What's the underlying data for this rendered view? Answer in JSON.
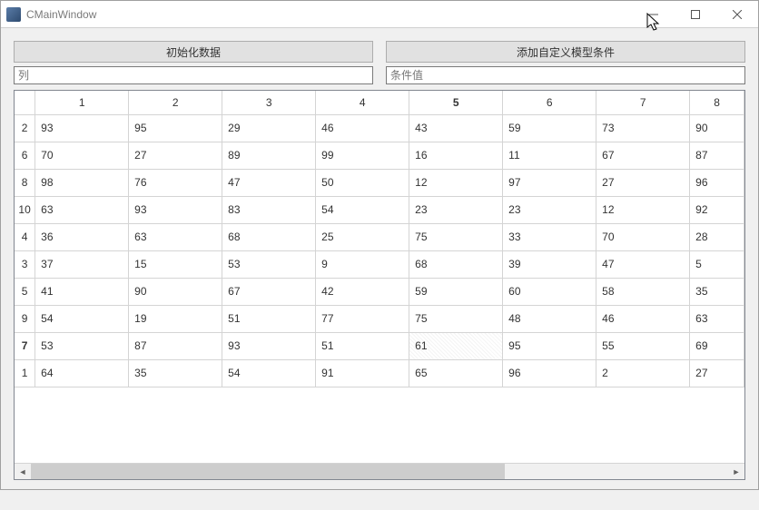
{
  "window": {
    "title": "CMainWindow"
  },
  "buttons": {
    "init": "初始化数据",
    "addcond": "添加自定义模型条件"
  },
  "inputs": {
    "col_placeholder": "列",
    "val_placeholder": "条件值"
  },
  "table": {
    "col_headers": [
      "1",
      "2",
      "3",
      "4",
      "5",
      "6",
      "7",
      "8"
    ],
    "bold_col_index": 4,
    "row_headers": [
      "2",
      "6",
      "8",
      "10",
      "4",
      "3",
      "5",
      "9",
      "7",
      "1"
    ],
    "bold_row_index": 8,
    "rows": [
      [
        "93",
        "95",
        "29",
        "46",
        "43",
        "59",
        "73",
        "90"
      ],
      [
        "70",
        "27",
        "89",
        "99",
        "16",
        "11",
        "67",
        "87"
      ],
      [
        "98",
        "76",
        "47",
        "50",
        "12",
        "97",
        "27",
        "96"
      ],
      [
        "63",
        "93",
        "83",
        "54",
        "23",
        "23",
        "12",
        "92"
      ],
      [
        "36",
        "63",
        "68",
        "25",
        "75",
        "33",
        "70",
        "28"
      ],
      [
        "37",
        "15",
        "53",
        "9",
        "68",
        "39",
        "47",
        "5"
      ],
      [
        "41",
        "90",
        "67",
        "42",
        "59",
        "60",
        "58",
        "35"
      ],
      [
        "54",
        "19",
        "51",
        "77",
        "75",
        "48",
        "46",
        "63"
      ],
      [
        "53",
        "87",
        "93",
        "51",
        "61",
        "95",
        "55",
        "69"
      ],
      [
        "64",
        "35",
        "54",
        "91",
        "65",
        "96",
        "2",
        "27"
      ]
    ],
    "selected_cell": {
      "row": 8,
      "col": 4
    }
  }
}
